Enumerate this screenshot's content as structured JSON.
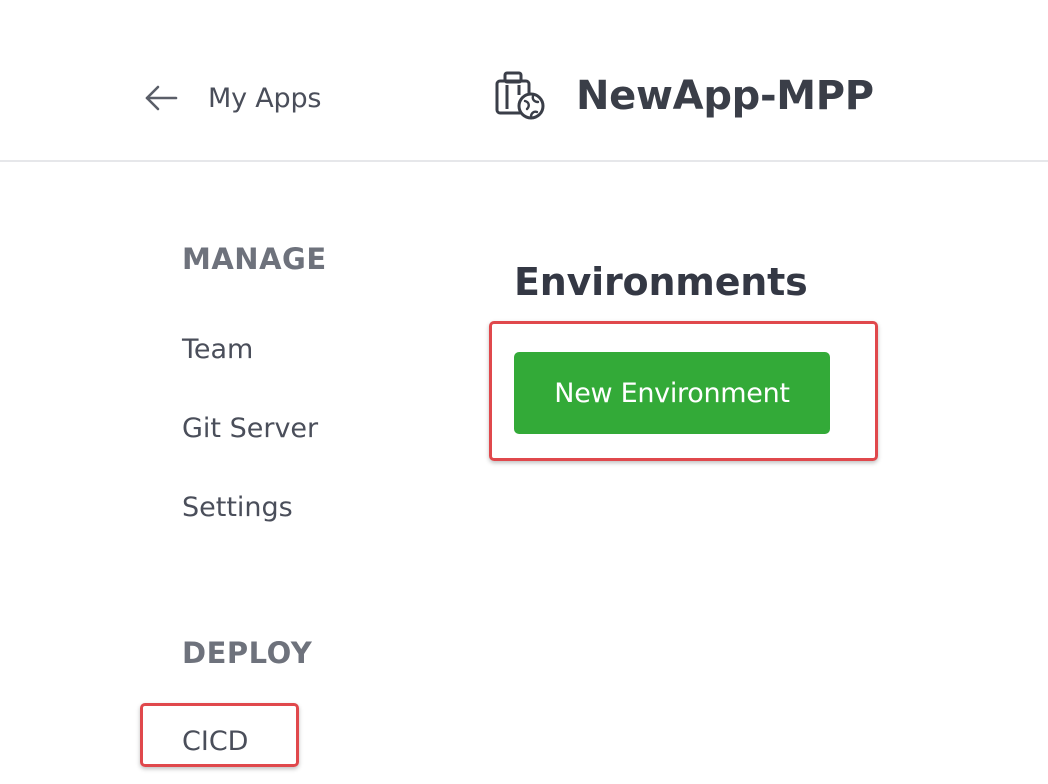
{
  "header": {
    "back_label": "My Apps",
    "app_name": "NewApp-MPP",
    "back_icon": "arrow-left-icon",
    "app_icon": "briefcase-globe-icon"
  },
  "sidebar": {
    "sections": [
      {
        "heading": "MANAGE",
        "items": [
          "Team",
          "Git Server",
          "Settings"
        ]
      },
      {
        "heading": "DEPLOY",
        "items": [
          "CICD"
        ]
      }
    ]
  },
  "main": {
    "title": "Environments",
    "new_environment_button": "New Environment"
  },
  "colors": {
    "button_green": "#33aa38",
    "highlight_red": "#e0484c",
    "divider": "#e6e7ea"
  }
}
